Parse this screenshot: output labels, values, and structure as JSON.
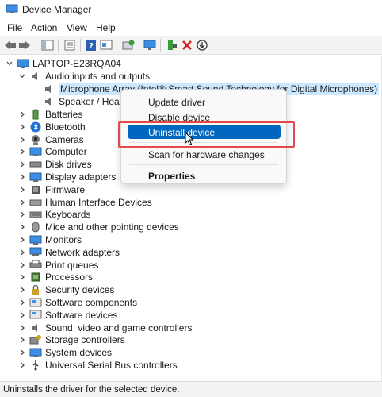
{
  "window": {
    "title": "Device Manager"
  },
  "menu": [
    "File",
    "Action",
    "View",
    "Help"
  ],
  "toolbar_icons": [
    "back-arrow-icon",
    "forward-arrow-icon",
    "show-hide-tree-icon",
    "properties-sheet-icon",
    "help-icon",
    "device-properties-icon",
    "scan-hardware-icon",
    "monitor-display-icon",
    "update-driver-icon",
    "uninstall-x-icon",
    "download-icon"
  ],
  "tree": {
    "root": "LAPTOP-E23RQA04",
    "audio": {
      "label": "Audio inputs and outputs",
      "children": [
        "Microphone Array (Intel® Smart Sound Technology for Digital Microphones)",
        "Speaker / Headph"
      ]
    },
    "categories": [
      "Batteries",
      "Bluetooth",
      "Cameras",
      "Computer",
      "Disk drives",
      "Display adapters",
      "Firmware",
      "Human Interface Devices",
      "Keyboards",
      "Mice and other pointing devices",
      "Monitors",
      "Network adapters",
      "Print queues",
      "Processors",
      "Security devices",
      "Software components",
      "Software devices",
      "Sound, video and game controllers",
      "Storage controllers",
      "System devices",
      "Universal Serial Bus controllers"
    ]
  },
  "context_menu": {
    "update": "Update driver",
    "disable": "Disable device",
    "uninstall": "Uninstall device",
    "scan": "Scan for hardware changes",
    "properties": "Properties"
  },
  "statusbar": {
    "text": "Uninstalls the driver for the selected device."
  },
  "colors": {
    "accent": "#0067c0",
    "selection": "#cce8ff",
    "callout": "#e8474a"
  }
}
